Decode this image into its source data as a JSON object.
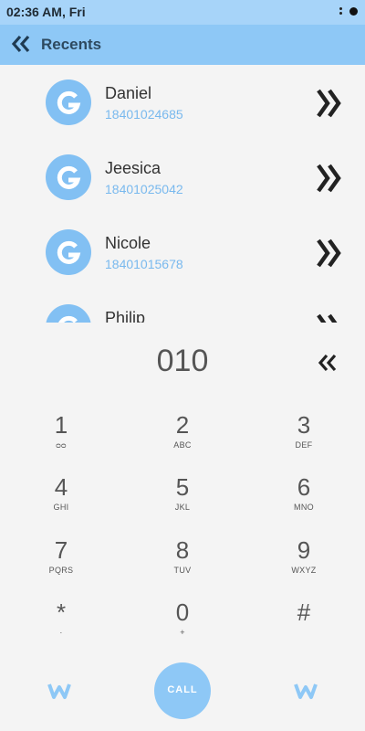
{
  "status_bar": {
    "time": "02:36 AM, Fri"
  },
  "header": {
    "title": "Recents",
    "back_icon": "double-chevron-left-icon"
  },
  "contacts": [
    {
      "name": "Daniel",
      "number": "18401024685"
    },
    {
      "name": "Jeesica",
      "number": "18401025042"
    },
    {
      "name": "Nicole",
      "number": "18401015678"
    },
    {
      "name": "Philip",
      "number": ""
    }
  ],
  "dialer": {
    "value": "010",
    "delete_icon": "double-chevron-left-icon"
  },
  "keys": [
    {
      "digit": "1",
      "letters": "ᴑᴑ"
    },
    {
      "digit": "2",
      "letters": "ABC"
    },
    {
      "digit": "3",
      "letters": "DEF"
    },
    {
      "digit": "4",
      "letters": "GHI"
    },
    {
      "digit": "5",
      "letters": "JKL"
    },
    {
      "digit": "6",
      "letters": "MNO"
    },
    {
      "digit": "7",
      "letters": "PQRS"
    },
    {
      "digit": "8",
      "letters": "TUV"
    },
    {
      "digit": "9",
      "letters": "WXYZ"
    },
    {
      "digit": "*",
      "letters": "·"
    },
    {
      "digit": "0",
      "letters": "+"
    },
    {
      "digit": "#",
      "letters": ""
    }
  ],
  "call": {
    "label": "CALL"
  },
  "colors": {
    "accent": "#8ec8f6",
    "status_bar": "#a7d4f9",
    "number_text": "#79b9ee"
  }
}
